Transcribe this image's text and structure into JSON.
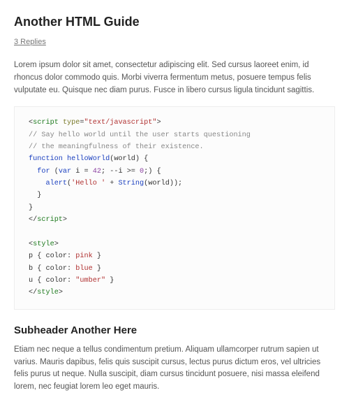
{
  "title": "Another HTML Guide",
  "replies_label": "3 Replies",
  "intro": "Lorem ipsum dolor sit amet, consectetur adipiscing elit. Sed cursus laoreet enim, id rhoncus dolor commodo quis. Morbi viverra fermentum metus, posuere tempus felis vulputate eu. Quisque nec diam purus. Fusce in libero cursus ligula tincidunt sagittis.",
  "code": {
    "lines": [
      [
        {
          "c": "t-op",
          "t": "<"
        },
        {
          "c": "t-tag",
          "t": "script"
        },
        {
          "c": "t-op",
          "t": " "
        },
        {
          "c": "t-attr",
          "t": "type"
        },
        {
          "c": "t-op",
          "t": "="
        },
        {
          "c": "t-str",
          "t": "\"text/javascript\""
        },
        {
          "c": "t-op",
          "t": ">"
        }
      ],
      [
        {
          "c": "t-cmt",
          "t": "// Say hello world until the user starts questioning"
        }
      ],
      [
        {
          "c": "t-cmt",
          "t": "// the meaningfulness of their existence."
        }
      ],
      [
        {
          "c": "t-kw",
          "t": "function"
        },
        {
          "c": "t-op",
          "t": " "
        },
        {
          "c": "t-fn",
          "t": "helloWorld"
        },
        {
          "c": "t-op",
          "t": "("
        },
        {
          "c": "t-ident",
          "t": "world"
        },
        {
          "c": "t-op",
          "t": ") {"
        }
      ],
      [
        {
          "c": "t-op",
          "t": "  "
        },
        {
          "c": "t-kw",
          "t": "for"
        },
        {
          "c": "t-op",
          "t": " ("
        },
        {
          "c": "t-kw",
          "t": "var"
        },
        {
          "c": "t-op",
          "t": " "
        },
        {
          "c": "t-ident",
          "t": "i"
        },
        {
          "c": "t-op",
          "t": " = "
        },
        {
          "c": "t-num",
          "t": "42"
        },
        {
          "c": "t-op",
          "t": "; --"
        },
        {
          "c": "t-ident",
          "t": "i"
        },
        {
          "c": "t-op",
          "t": " >= "
        },
        {
          "c": "t-num",
          "t": "0"
        },
        {
          "c": "t-op",
          "t": ";) {"
        }
      ],
      [
        {
          "c": "t-op",
          "t": "    "
        },
        {
          "c": "t-builtin",
          "t": "alert"
        },
        {
          "c": "t-op",
          "t": "("
        },
        {
          "c": "t-str",
          "t": "'Hello '"
        },
        {
          "c": "t-op",
          "t": " + "
        },
        {
          "c": "t-builtin",
          "t": "String"
        },
        {
          "c": "t-op",
          "t": "("
        },
        {
          "c": "t-ident",
          "t": "world"
        },
        {
          "c": "t-op",
          "t": "));"
        }
      ],
      [
        {
          "c": "t-op",
          "t": "  }"
        }
      ],
      [
        {
          "c": "t-op",
          "t": "}"
        }
      ],
      [
        {
          "c": "t-op",
          "t": "</"
        },
        {
          "c": "t-tag",
          "t": "script"
        },
        {
          "c": "t-op",
          "t": ">"
        }
      ],
      [
        {
          "c": "t-op",
          "t": " "
        }
      ],
      [
        {
          "c": "t-op",
          "t": "<"
        },
        {
          "c": "t-tag",
          "t": "style"
        },
        {
          "c": "t-op",
          "t": ">"
        }
      ],
      [
        {
          "c": "t-css-sel",
          "t": "p"
        },
        {
          "c": "t-op",
          "t": " { "
        },
        {
          "c": "t-css-prop",
          "t": "color"
        },
        {
          "c": "t-op",
          "t": ": "
        },
        {
          "c": "t-css-val",
          "t": "pink"
        },
        {
          "c": "t-op",
          "t": " }"
        }
      ],
      [
        {
          "c": "t-css-sel",
          "t": "b"
        },
        {
          "c": "t-op",
          "t": " { "
        },
        {
          "c": "t-css-prop",
          "t": "color"
        },
        {
          "c": "t-op",
          "t": ": "
        },
        {
          "c": "t-css-val",
          "t": "blue"
        },
        {
          "c": "t-op",
          "t": " }"
        }
      ],
      [
        {
          "c": "t-css-sel",
          "t": "u"
        },
        {
          "c": "t-op",
          "t": " { "
        },
        {
          "c": "t-css-prop",
          "t": "color"
        },
        {
          "c": "t-op",
          "t": ": "
        },
        {
          "c": "t-str",
          "t": "\"umber\""
        },
        {
          "c": "t-op",
          "t": " }"
        }
      ],
      [
        {
          "c": "t-op",
          "t": "</"
        },
        {
          "c": "t-tag",
          "t": "style"
        },
        {
          "c": "t-op",
          "t": ">"
        }
      ]
    ]
  },
  "subheader": "Subheader Another Here",
  "body2": "Etiam nec neque a tellus condimentum pretium. Aliquam ullamcorper rutrum sapien ut varius. Mauris dapibus, felis quis suscipit cursus, lectus purus dictum eros, vel ultricies felis purus ut neque. Nulla suscipit, diam cursus tincidunt posuere, nisi massa eleifend lorem, nec feugiat lorem leo eget mauris."
}
